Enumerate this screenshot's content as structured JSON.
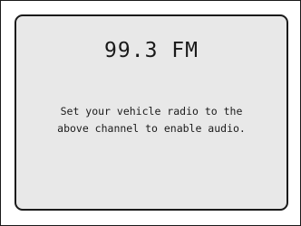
{
  "display": {
    "frequency": "99.3 FM",
    "instructions": {
      "line1": "Set your vehicle radio to the",
      "line2": "above channel to enable audio."
    }
  },
  "colors": {
    "panel_background": "#e8e8e8",
    "border": "#1a1a1a",
    "text": "#1a1a1a",
    "page_background": "#ffffff"
  }
}
